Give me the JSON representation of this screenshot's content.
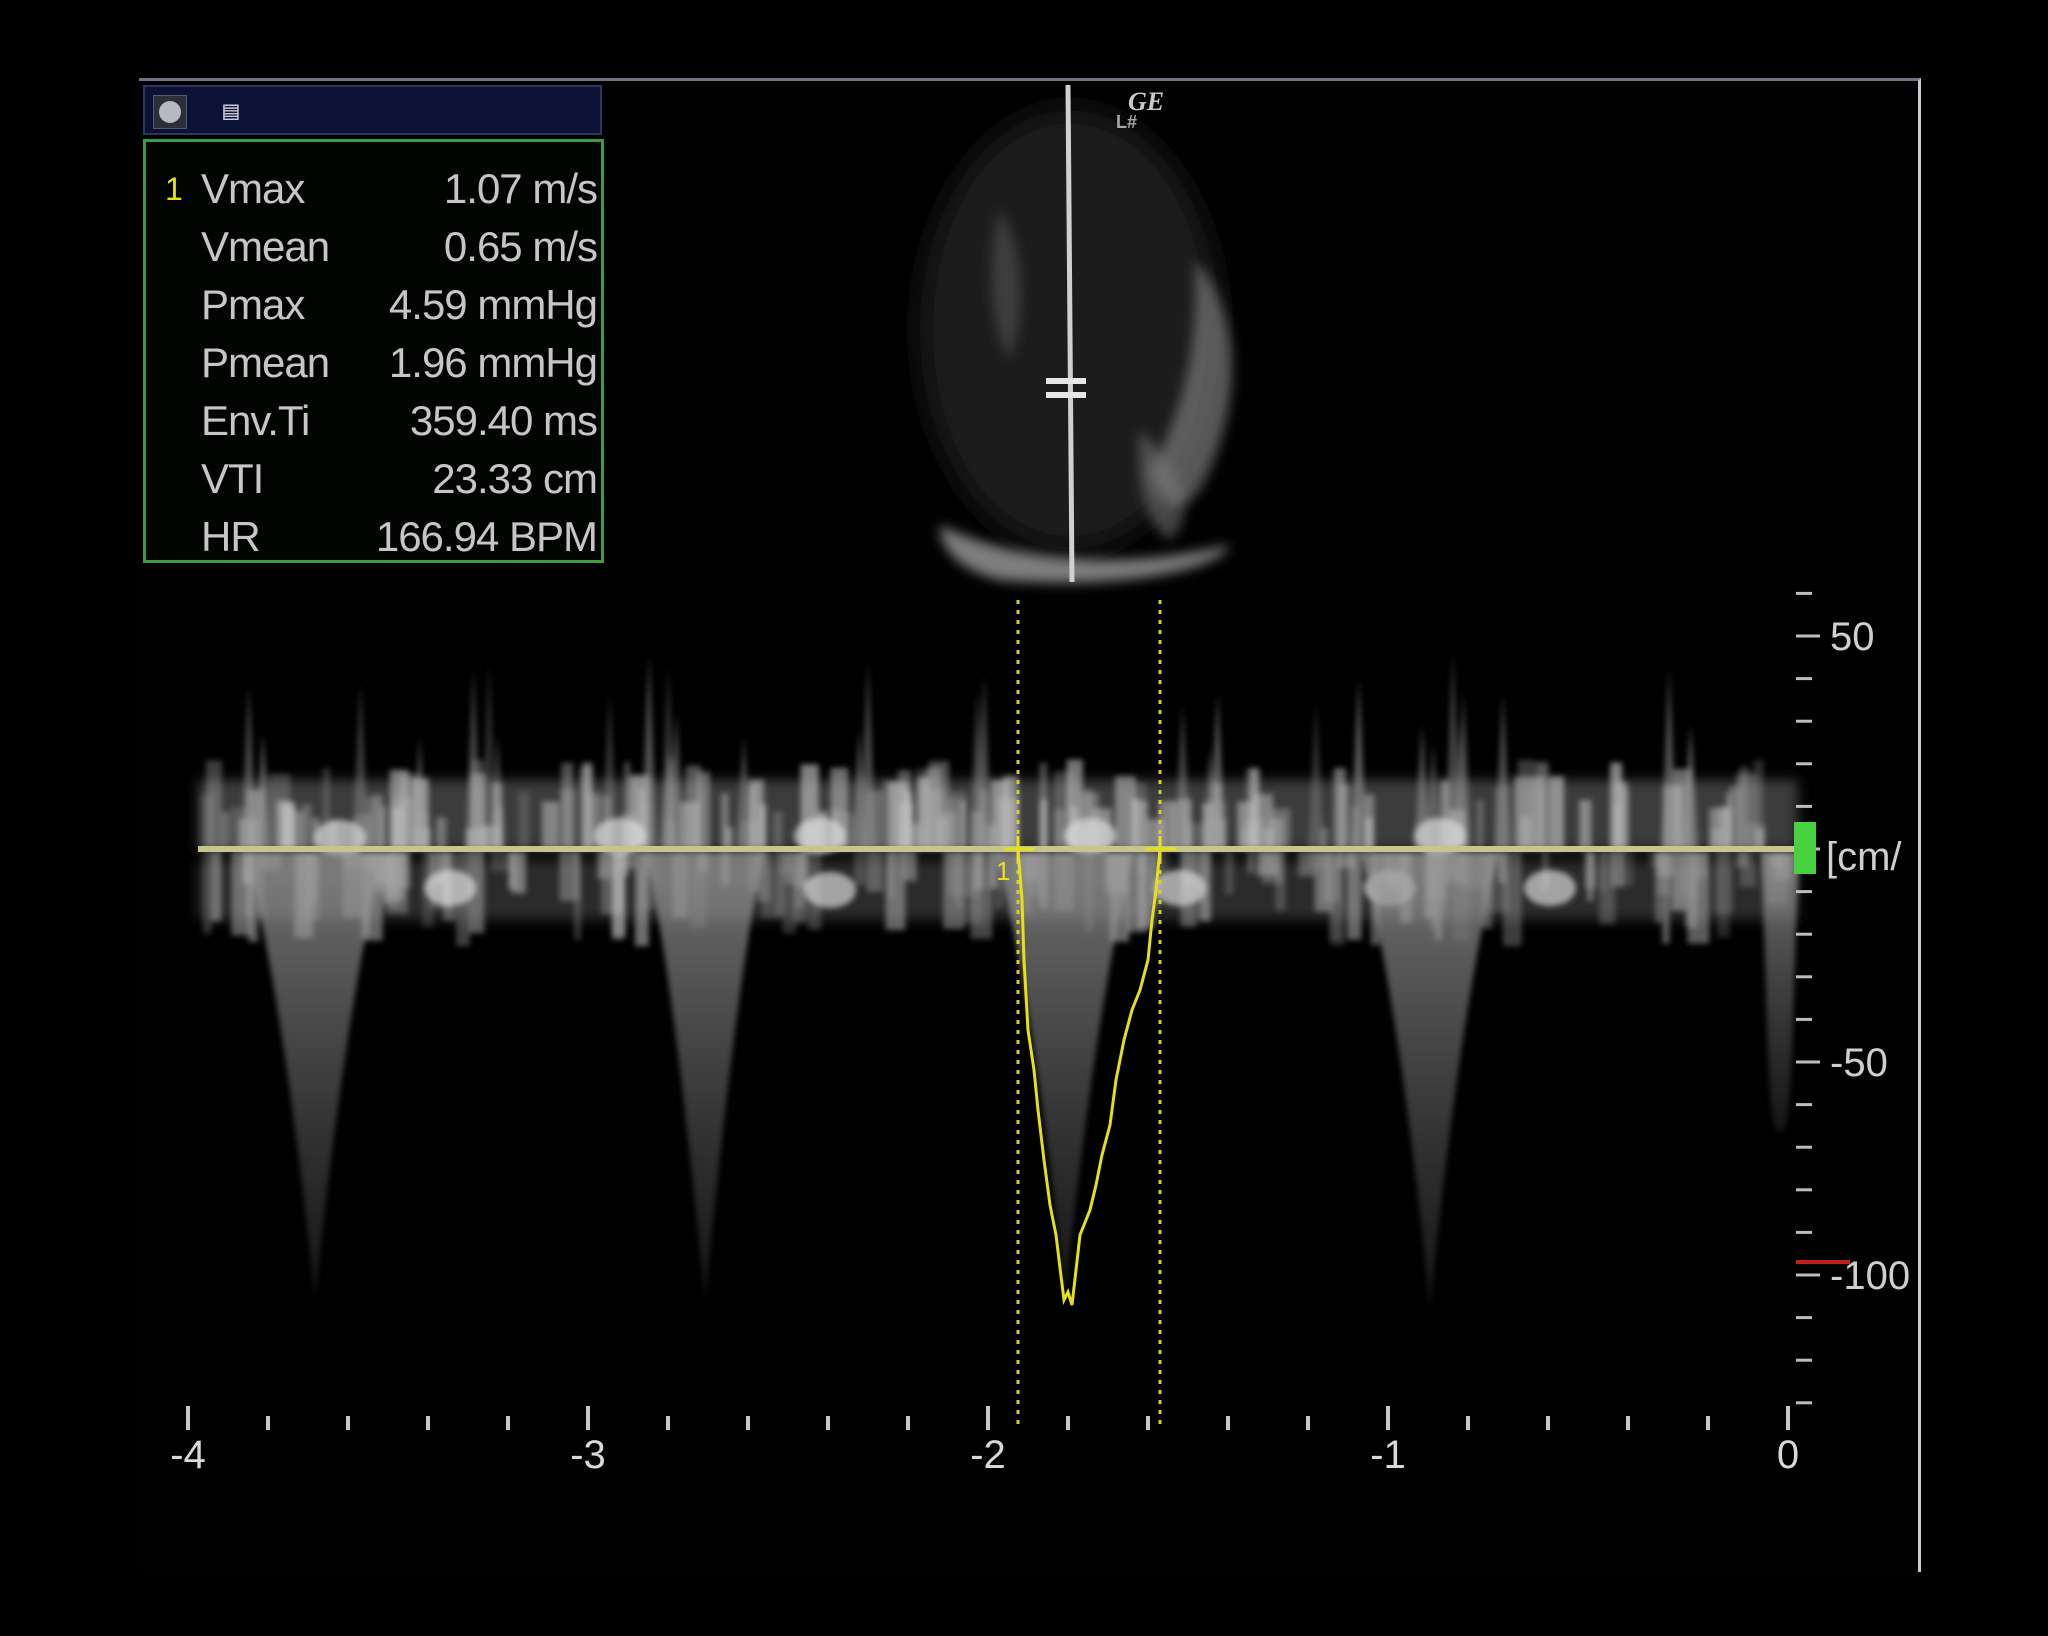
{
  "panel": {
    "header_icons": [
      "record-icon",
      "report-icon"
    ],
    "measurement_index": "1",
    "rows": [
      {
        "label": "Vmax",
        "value": "1.07 m/s"
      },
      {
        "label": "Vmean",
        "value": "0.65 m/s"
      },
      {
        "label": "Pmax",
        "value": "4.59 mmHg"
      },
      {
        "label": "Pmean",
        "value": "1.96 mmHg"
      },
      {
        "label": "Env.Ti",
        "value": "359.40 ms"
      },
      {
        "label": "VTI",
        "value": "23.33 cm"
      },
      {
        "label": "HR",
        "value": "166.94 BPM"
      }
    ]
  },
  "logo": {
    "line1": "GE",
    "line2": "L#"
  },
  "velocity_scale": {
    "labels": [
      "50",
      "-50",
      "-100"
    ],
    "label_values": [
      50,
      -50,
      -100
    ],
    "unit": "[cm/"
  },
  "time_axis": {
    "labels": [
      "-4",
      "-3",
      "-2",
      "-1",
      "0"
    ],
    "values": [
      -4,
      -3,
      -2,
      -1,
      0
    ]
  },
  "measurement": {
    "marker_label": "1",
    "start_time_s": -1.95,
    "end_time_s": -1.59
  },
  "colors": {
    "panel_border": "#3f9b41",
    "measure_trace": "#e6e01a",
    "baseline": "#c8c58a",
    "scale_marker": "#49d240",
    "scale_alarm": "#c0201c",
    "text": "#c6c6c6"
  }
}
